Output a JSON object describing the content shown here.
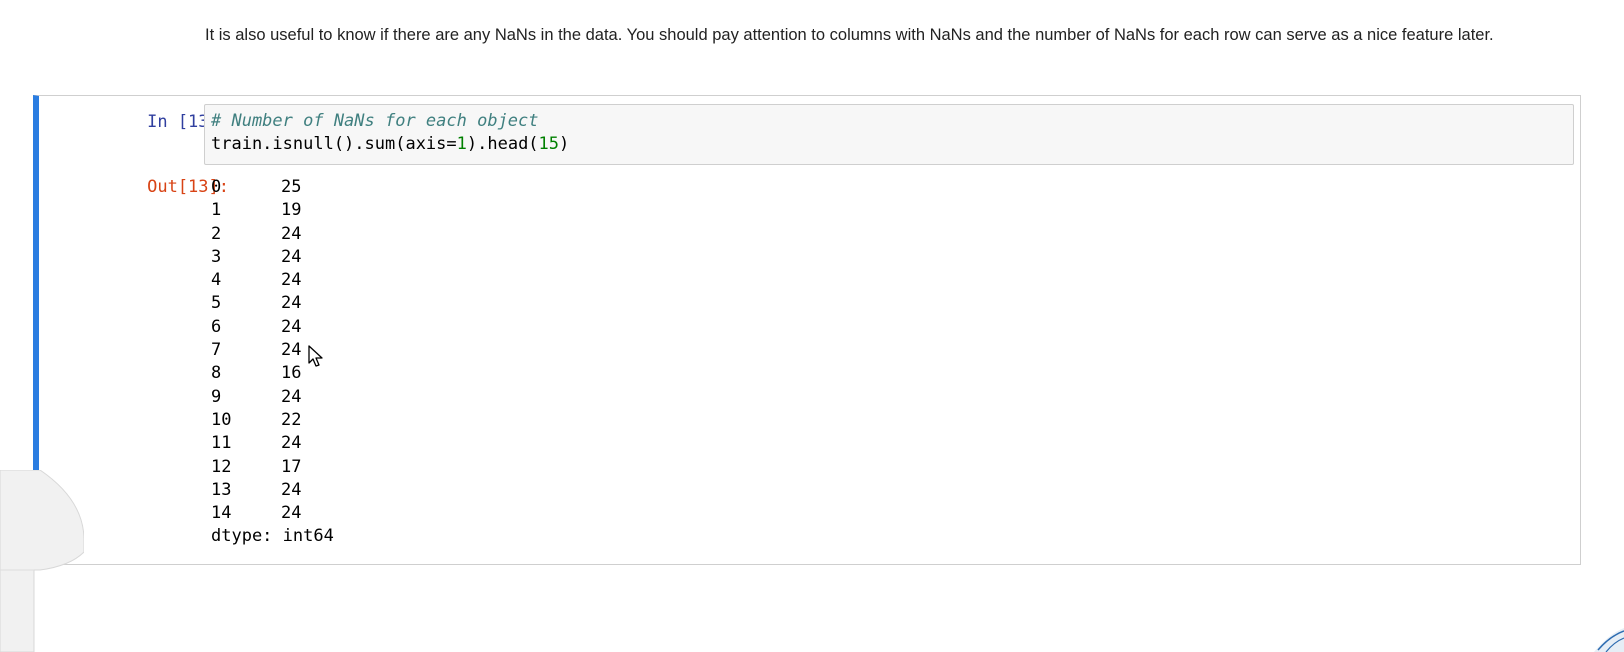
{
  "markdown": {
    "text": "It is also useful to know if there are any NaNs in the data. You should pay attention to columns with NaNs and the number of NaNs for each row can serve as a nice feature later."
  },
  "cell": {
    "in_prompt": "In [13]:",
    "out_prompt": "Out[13]:",
    "code_comment": "# Number of NaNs for each object",
    "code_prefix": "train.isnull().sum(axis=",
    "code_axis_value": "1",
    "code_mid": ").head(",
    "code_head_value": "15",
    "code_suffix": ")",
    "output_rows": [
      {
        "index": "0",
        "value": "25"
      },
      {
        "index": "1",
        "value": "19"
      },
      {
        "index": "2",
        "value": "24"
      },
      {
        "index": "3",
        "value": "24"
      },
      {
        "index": "4",
        "value": "24"
      },
      {
        "index": "5",
        "value": "24"
      },
      {
        "index": "6",
        "value": "24"
      },
      {
        "index": "7",
        "value": "24"
      },
      {
        "index": "8",
        "value": "16"
      },
      {
        "index": "9",
        "value": "24"
      },
      {
        "index": "10",
        "value": "22"
      },
      {
        "index": "11",
        "value": "24"
      },
      {
        "index": "12",
        "value": "17"
      },
      {
        "index": "13",
        "value": "24"
      },
      {
        "index": "14",
        "value": "24"
      }
    ],
    "dtype_line": "dtype: int64"
  },
  "colors": {
    "selected_cell_border": "#2a7de1",
    "in_prompt": "#303f9f",
    "out_prompt": "#d84315",
    "comment": "#408080",
    "number": "#008000"
  },
  "icons": {
    "cursor": "mouse-pointer-icon"
  }
}
